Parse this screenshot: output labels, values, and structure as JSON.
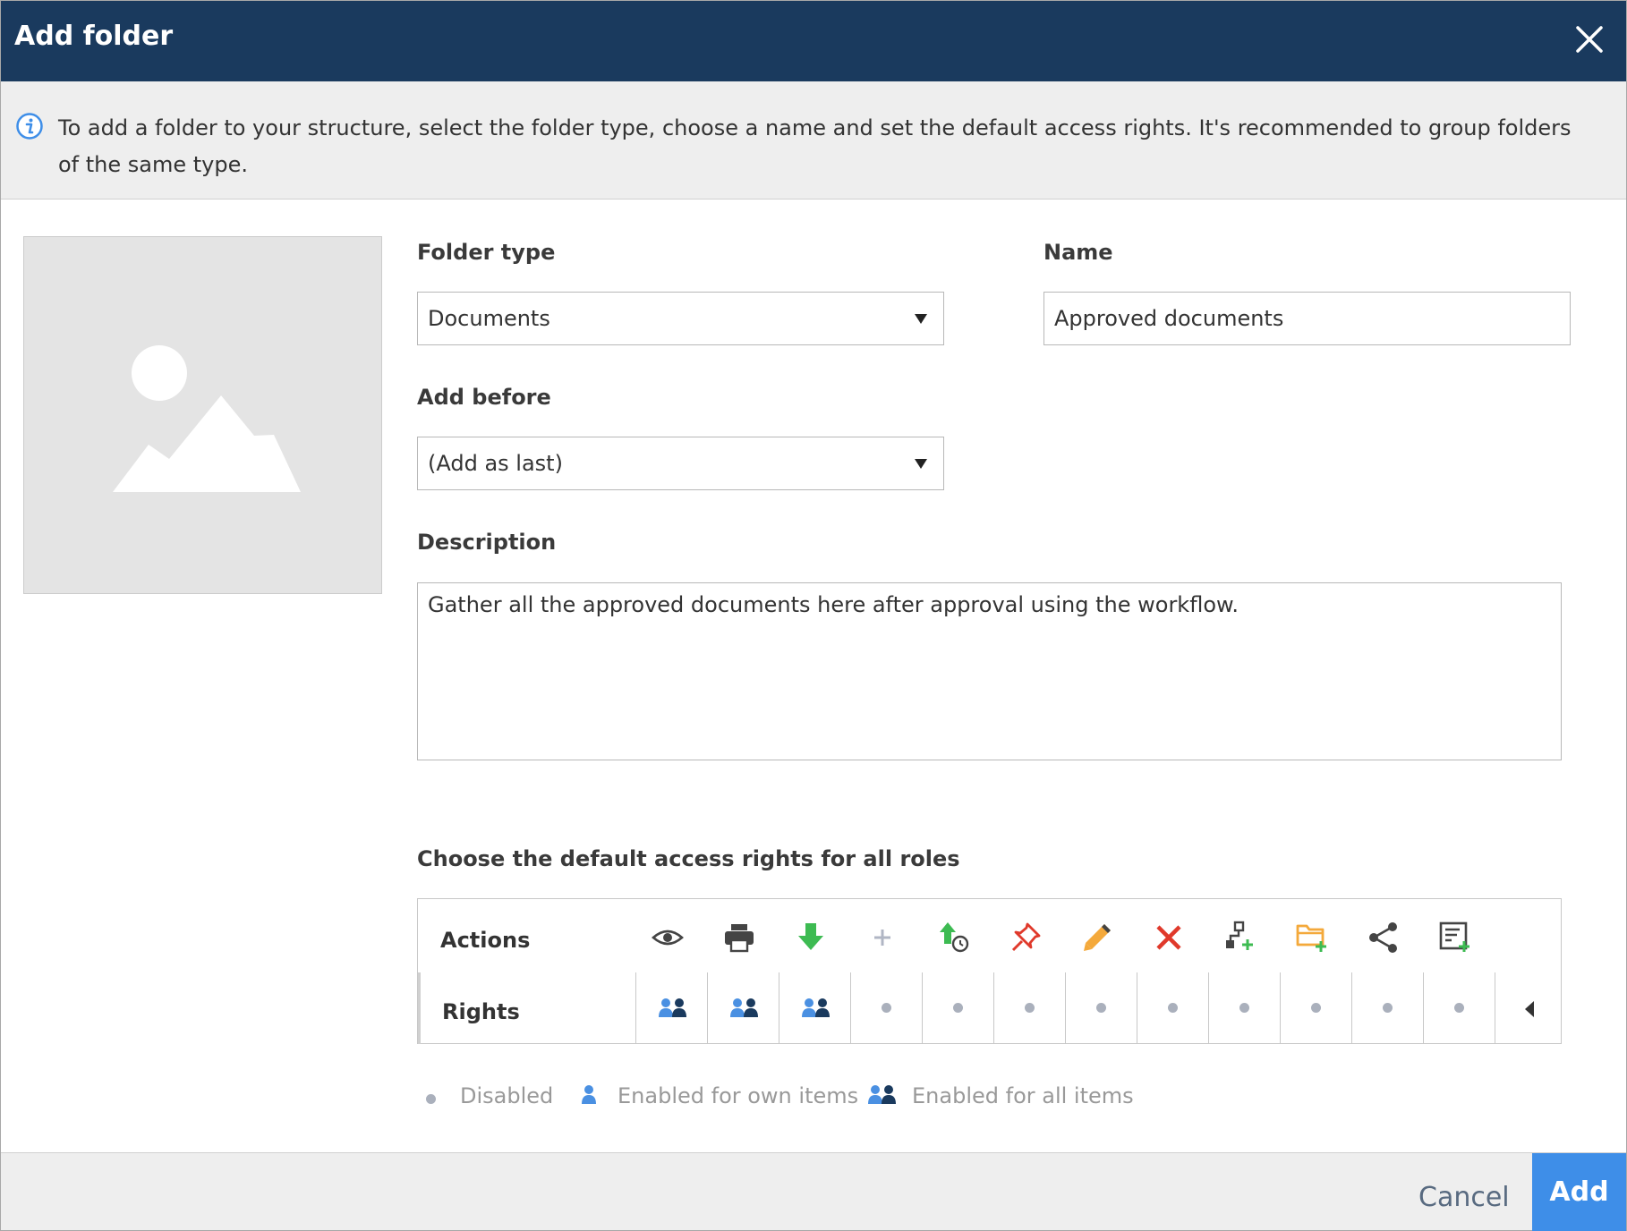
{
  "dialog": {
    "title": "Add folder",
    "info_text": "To add a folder to your structure, select the folder type, choose a name and set the default access rights. It's recommended to group folders of the same type."
  },
  "form": {
    "folder_type": {
      "label": "Folder type",
      "value": "Documents"
    },
    "name": {
      "label": "Name",
      "value": "Approved documents"
    },
    "add_before": {
      "label": "Add before",
      "value": "(Add as last)"
    },
    "description": {
      "label": "Description",
      "value": "Gather all the approved documents here after approval using the workflow."
    }
  },
  "access_rights": {
    "heading": "Choose the default access rights for all roles",
    "actions_label": "Actions",
    "rights_label": "Rights",
    "actions": [
      {
        "icon": "eye-icon",
        "right": "all"
      },
      {
        "icon": "printer-icon",
        "right": "all"
      },
      {
        "icon": "download-arrow-icon",
        "right": "all"
      },
      {
        "icon": "plus-icon",
        "right": "disabled"
      },
      {
        "icon": "upload-clock-icon",
        "right": "disabled"
      },
      {
        "icon": "pin-icon",
        "right": "disabled"
      },
      {
        "icon": "pencil-icon",
        "right": "disabled"
      },
      {
        "icon": "delete-x-icon",
        "right": "disabled"
      },
      {
        "icon": "workflow-add-icon",
        "right": "disabled"
      },
      {
        "icon": "folder-add-icon",
        "right": "disabled"
      },
      {
        "icon": "share-icon",
        "right": "disabled"
      },
      {
        "icon": "form-add-icon",
        "right": "disabled"
      }
    ]
  },
  "legend": {
    "disabled": "Disabled",
    "own": "Enabled for own items",
    "all": "Enabled for all items"
  },
  "footer": {
    "cancel": "Cancel",
    "add": "Add"
  },
  "colors": {
    "header": "#1a3a5e",
    "primary": "#3e8ee8",
    "user_light": "#4a90e2",
    "user_dark": "#1a3a5e",
    "disabled_dot": "#aab0bc"
  }
}
